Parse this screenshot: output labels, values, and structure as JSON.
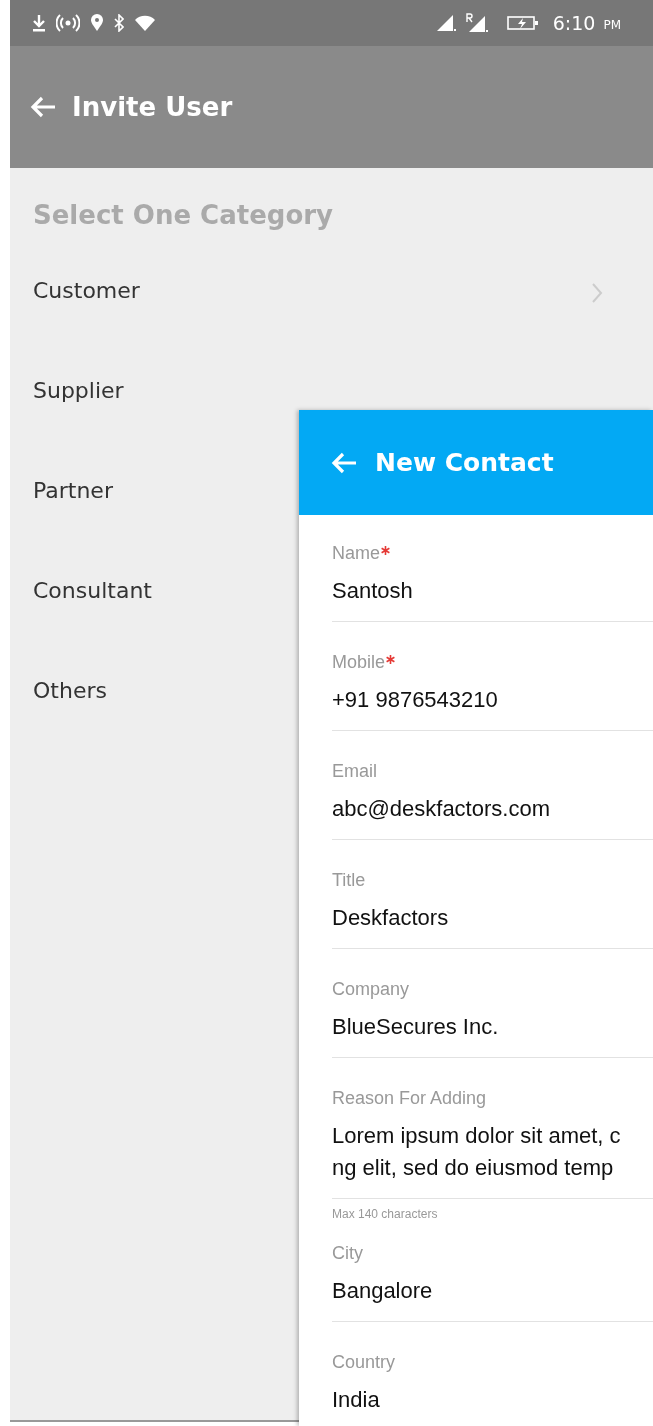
{
  "status_bar": {
    "time": "6:10",
    "period": "PM"
  },
  "app_bar": {
    "title": "Invite User"
  },
  "category": {
    "heading": "Select One Category",
    "items": [
      {
        "label": "Customer",
        "chevron": true
      },
      {
        "label": "Supplier"
      },
      {
        "label": "Partner"
      },
      {
        "label": "Consultant"
      },
      {
        "label": "Others"
      }
    ]
  },
  "panel": {
    "title": "New Contact",
    "fields": [
      {
        "label": "Name",
        "required": true,
        "value_lines": [
          "Santosh"
        ]
      },
      {
        "label": "Mobile",
        "required": true,
        "value_lines": [
          "+91 9876543210"
        ]
      },
      {
        "label": "Email",
        "required": false,
        "value_lines": [
          "abc@deskfactors.com"
        ]
      },
      {
        "label": "Title",
        "required": false,
        "value_lines": [
          "Deskfactors"
        ]
      },
      {
        "label": "Company",
        "required": false,
        "value_lines": [
          "BlueSecures Inc."
        ]
      },
      {
        "label": "Reason For Adding",
        "required": false,
        "value_lines": [
          "Lorem ipsum dolor sit amet, c",
          "ng elit, sed do eiusmod temp"
        ],
        "hint": "Max 140 characters"
      },
      {
        "label": "City",
        "required": false,
        "value_lines": [
          "Bangalore"
        ]
      },
      {
        "label": "Country",
        "required": false,
        "value_lines": [
          "India"
        ]
      }
    ]
  }
}
